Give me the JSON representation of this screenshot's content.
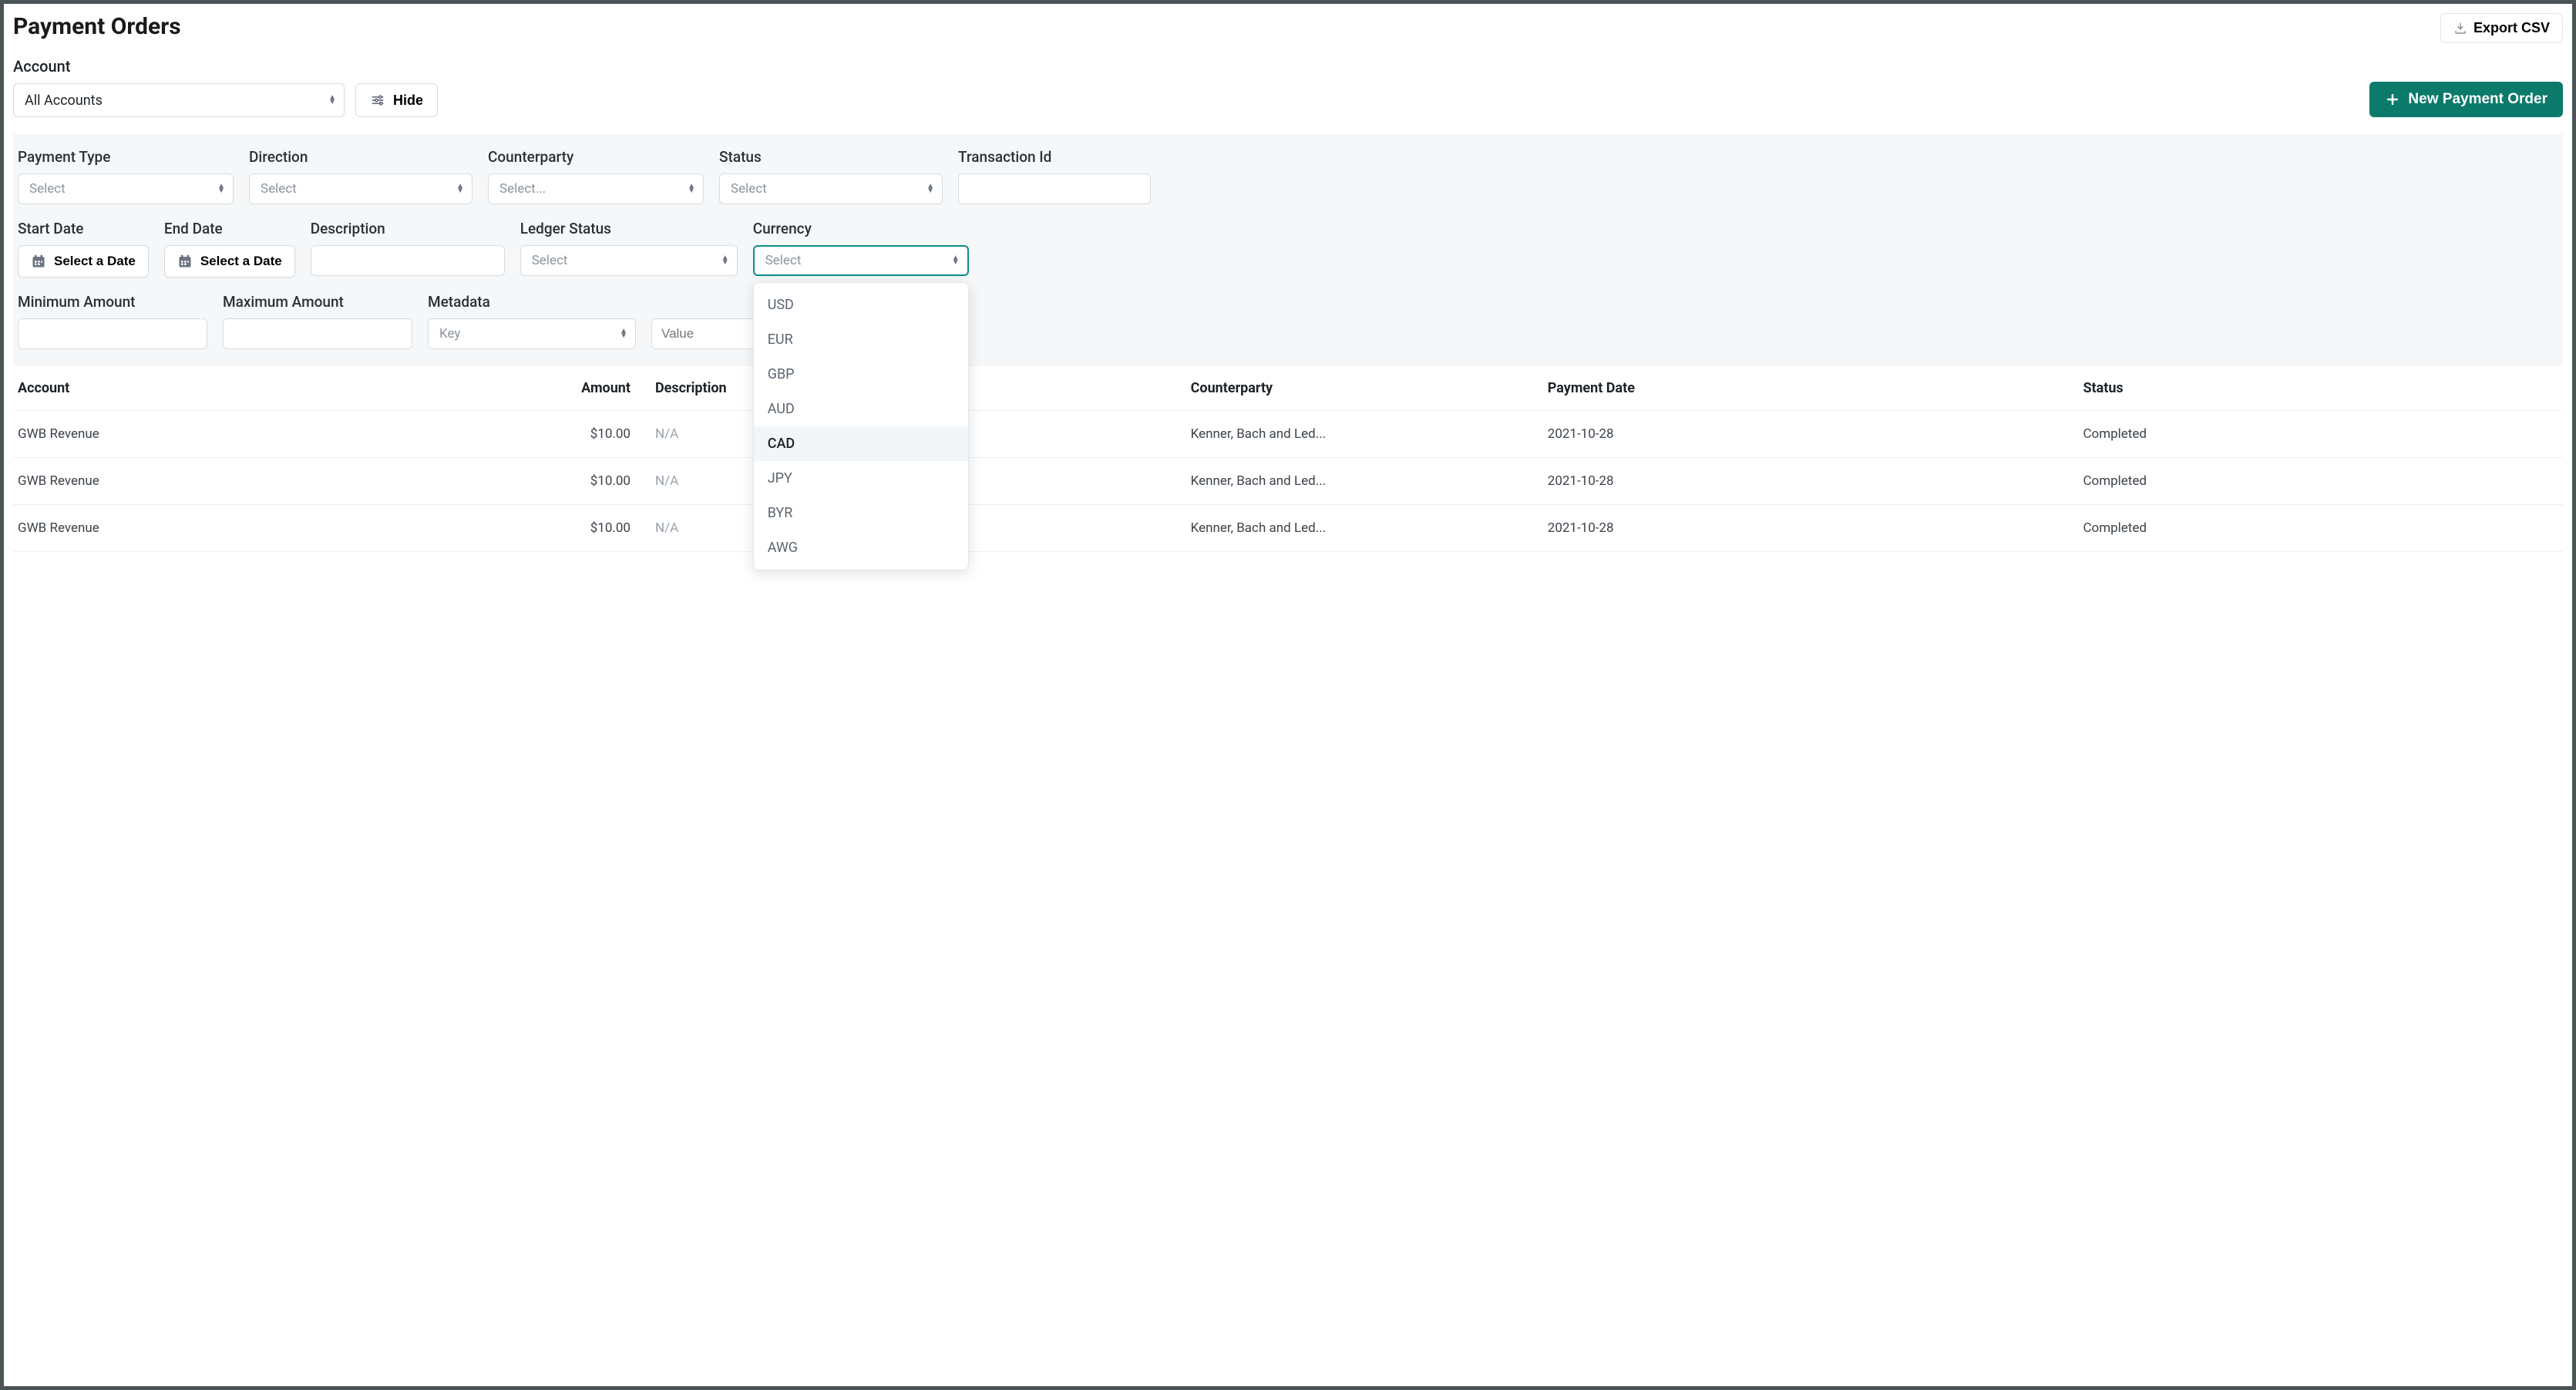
{
  "page_title": "Payment Orders",
  "export_label": "Export CSV",
  "account_label": "Account",
  "account_value": "All Accounts",
  "hide_label": "Hide",
  "new_label": "New Payment Order",
  "filters": {
    "payment_type": {
      "label": "Payment Type",
      "placeholder": "Select"
    },
    "direction": {
      "label": "Direction",
      "placeholder": "Select"
    },
    "counterparty": {
      "label": "Counterparty",
      "placeholder": "Select..."
    },
    "status": {
      "label": "Status",
      "placeholder": "Select"
    },
    "transaction_id": {
      "label": "Transaction Id"
    },
    "start_date": {
      "label": "Start Date",
      "button": "Select a Date"
    },
    "end_date": {
      "label": "End Date",
      "button": "Select a Date"
    },
    "description": {
      "label": "Description"
    },
    "ledger_status": {
      "label": "Ledger Status",
      "placeholder": "Select"
    },
    "currency": {
      "label": "Currency",
      "placeholder": "Select"
    },
    "min_amount": {
      "label": "Minimum Amount"
    },
    "max_amount": {
      "label": "Maximum Amount"
    },
    "metadata": {
      "label": "Metadata",
      "key_placeholder": "Key",
      "value_placeholder": "Value"
    }
  },
  "currency_options": [
    "USD",
    "EUR",
    "GBP",
    "AUD",
    "CAD",
    "JPY",
    "BYR",
    "AWG"
  ],
  "currency_hovered": "CAD",
  "table": {
    "headers": {
      "account": "Account",
      "amount": "Amount",
      "description": "Description",
      "counterparty": "Counterparty",
      "payment_date": "Payment Date",
      "status": "Status"
    },
    "rows": [
      {
        "account": "GWB Revenue",
        "amount": "$10.00",
        "description": "N/A",
        "counterparty": "Kenner, Bach and Led...",
        "payment_date": "2021-10-28",
        "status": "Completed"
      },
      {
        "account": "GWB Revenue",
        "amount": "$10.00",
        "description": "N/A",
        "counterparty": "Kenner, Bach and Led...",
        "payment_date": "2021-10-28",
        "status": "Completed"
      },
      {
        "account": "GWB Revenue",
        "amount": "$10.00",
        "description": "N/A",
        "counterparty": "Kenner, Bach and Led...",
        "payment_date": "2021-10-28",
        "status": "Completed"
      }
    ]
  }
}
